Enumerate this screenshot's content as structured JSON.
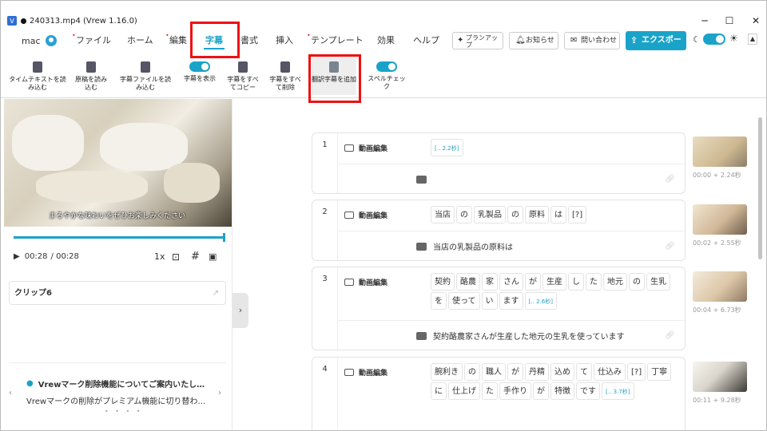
{
  "window": {
    "title": "240313.mp4 (Vrew 1.16.0)",
    "app_icon": "V",
    "minimize": "─",
    "maximize": "☐",
    "close": "✕"
  },
  "menu": {
    "user": "mac",
    "items": [
      {
        "label": "ファイル",
        "dot": true
      },
      {
        "label": "ホーム",
        "dot": false
      },
      {
        "label": "編集",
        "dot": true
      },
      {
        "label": "字幕",
        "dot": false,
        "active": true
      },
      {
        "label": "書式",
        "dot": false
      },
      {
        "label": "挿入",
        "dot": false
      },
      {
        "label": "テンプレート",
        "dot": true
      },
      {
        "label": "効果",
        "dot": false
      },
      {
        "label": "ヘルプ",
        "dot": false
      }
    ],
    "plan_button": "プランアップ",
    "notice_button": "お知らせ",
    "contact_button": "問い合わせ",
    "export_button": "エクスポート"
  },
  "toolbar": {
    "items": [
      {
        "label": "タイムテキストを読み込む"
      },
      {
        "label": "原稿を読み込む"
      },
      {
        "label": "字幕ファイルを読み込む"
      },
      {
        "label": "字幕を表示"
      },
      {
        "label": "字幕をすべてコピー"
      },
      {
        "label": "字幕をすべて削除"
      },
      {
        "label": "翻訳字幕を追加"
      },
      {
        "label": "スペルチェック"
      }
    ]
  },
  "player": {
    "caption": "まろやかな味わいをぜひお楽しみください",
    "current_time": "00:28",
    "total_time": "/ 00:28",
    "speed": "1x",
    "progress": 1.0
  },
  "clip": {
    "name": "クリップ6"
  },
  "notice": {
    "title": "Vrewマーク削除機能についてご案内いたし…",
    "body": "Vrewマークの削除がプレミアム機能に切り替わ…"
  },
  "clips": [
    {
      "number": "1",
      "speaker": "動画編集",
      "tokens": [
        {
          "t": "[‥ 2.2秒]",
          "gap": true
        }
      ],
      "subtitle": "",
      "time": "00:00 + 2.24秒"
    },
    {
      "number": "2",
      "speaker": "動画編集",
      "tokens": [
        {
          "t": "当店"
        },
        {
          "t": "の"
        },
        {
          "t": "乳製品"
        },
        {
          "t": "の"
        },
        {
          "t": "原料"
        },
        {
          "t": "は"
        },
        {
          "t": "[?]"
        }
      ],
      "subtitle": "当店の乳製品の原料は",
      "time": "00:02 + 2.55秒"
    },
    {
      "number": "3",
      "speaker": "動画編集",
      "tokens": [
        {
          "t": "契約"
        },
        {
          "t": "酪農"
        },
        {
          "t": "家"
        },
        {
          "t": "さん"
        },
        {
          "t": "が"
        },
        {
          "t": "生産"
        },
        {
          "t": "し"
        },
        {
          "t": "た"
        },
        {
          "t": "地元"
        },
        {
          "t": "の"
        },
        {
          "t": "生乳"
        },
        {
          "t": "を"
        },
        {
          "t": "使って"
        },
        {
          "t": "い"
        },
        {
          "t": "ます"
        },
        {
          "t": "[‥ 2.6秒]",
          "gap": true
        }
      ],
      "subtitle": "契約酪農家さんが生産した地元の生乳を使っています",
      "time": "00:04 + 6.73秒"
    },
    {
      "number": "4",
      "speaker": "動画編集",
      "tokens": [
        {
          "t": "腕利き"
        },
        {
          "t": "の"
        },
        {
          "t": "職人"
        },
        {
          "t": "が"
        },
        {
          "t": "丹精"
        },
        {
          "t": "込め"
        },
        {
          "t": "て"
        },
        {
          "t": "仕込み"
        },
        {
          "t": "[?]"
        },
        {
          "t": "丁寧"
        },
        {
          "t": "に"
        },
        {
          "t": "仕上げ"
        },
        {
          "t": "た"
        },
        {
          "t": "手作り"
        },
        {
          "t": "が"
        },
        {
          "t": "特徴"
        },
        {
          "t": "です"
        },
        {
          "t": "[‥ 3.7秒]",
          "gap": true
        }
      ],
      "subtitle": "",
      "time": "00:11 + 9.28秒"
    }
  ],
  "colors": {
    "accent": "#1aa3c8",
    "highlight_box": "#e11111"
  }
}
